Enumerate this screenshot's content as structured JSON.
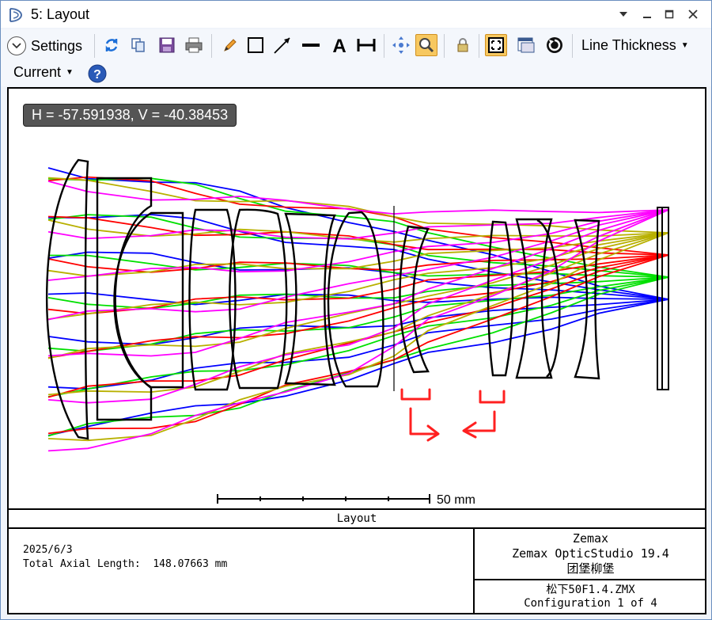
{
  "window": {
    "title": "5: Layout",
    "controls": [
      "chevron-down-icon",
      "minimize-icon",
      "maximize-icon",
      "close-icon"
    ]
  },
  "toolbar": {
    "settings_label": "Settings",
    "line_thickness_label": "Line Thickness",
    "current_label": "Current"
  },
  "plot": {
    "coordinate_readout": "H = -57.591938, V = -40.38453",
    "scale_label": "50 mm",
    "caption": "Layout",
    "date": "2025/6/3",
    "axial_length": "Total Axial Length:  148.07663 mm",
    "company": "Zemax",
    "software": "Zemax OpticStudio 19.4",
    "author": "团堡柳堡",
    "filename": "松下50F1.4.ZMX",
    "configuration": "Configuration 1 of 4"
  },
  "colors": {
    "ray_blue": "#0000ff",
    "ray_green": "#00e000",
    "ray_red": "#ff0000",
    "ray_olive": "#b8b000",
    "ray_magenta": "#ff00ff",
    "annotation_red": "#ff2020"
  }
}
